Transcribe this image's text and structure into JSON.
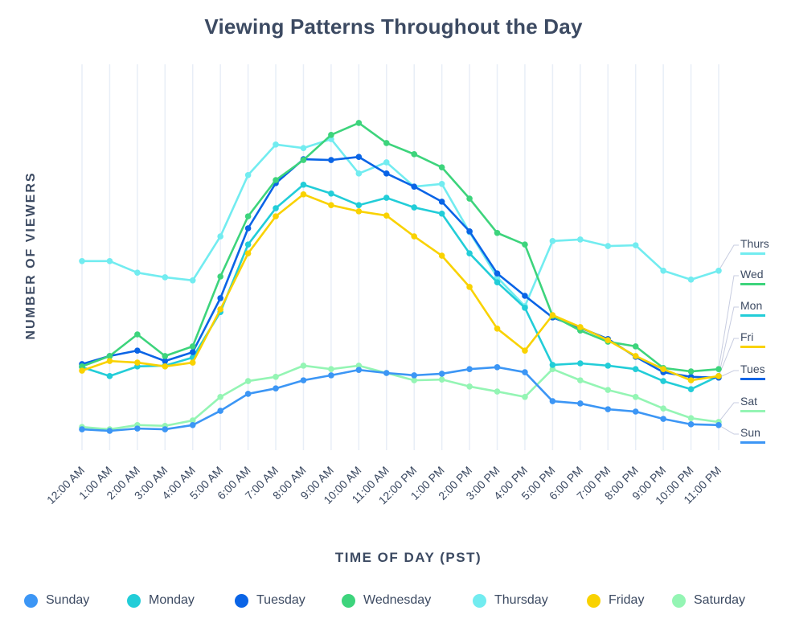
{
  "chart_data": {
    "type": "line",
    "title": "Viewing Patterns Throughout the Day",
    "xlabel": "TIME OF DAY (PST)",
    "ylabel": "NUMBER OF VIEWERS",
    "y_units": "relative index (no y-axis ticks shown)",
    "ylim": [
      0,
      100
    ],
    "grid": "vertical",
    "legend_position": "bottom",
    "categories": [
      "12:00 AM",
      "1:00 AM",
      "2:00 AM",
      "3:00 AM",
      "4:00 AM",
      "5:00 AM",
      "6:00 AM",
      "7:00 AM",
      "8:00 AM",
      "9:00 AM",
      "10:00 AM",
      "11:00 AM",
      "12:00 PM",
      "1:00 PM",
      "2:00 PM",
      "3:00 PM",
      "4:00 PM",
      "5:00 PM",
      "6:00 PM",
      "7:00 PM",
      "8:00 PM",
      "9:00 PM",
      "10:00 PM",
      "11:00 PM"
    ],
    "series": [
      {
        "name": "Sunday",
        "short": "Sun",
        "color": "#3c96f5",
        "values": [
          5.4,
          5.0,
          5.6,
          5.4,
          6.5,
          10.2,
          14.6,
          16.0,
          18.1,
          19.4,
          20.8,
          20.0,
          19.4,
          19.8,
          21.0,
          21.5,
          20.2,
          12.7,
          12.1,
          10.6,
          10.0,
          8.1,
          6.7,
          6.5
        ]
      },
      {
        "name": "Monday",
        "short": "Mon",
        "color": "#22cdd8",
        "values": [
          21.5,
          19.2,
          21.7,
          21.9,
          24.0,
          35.8,
          53.3,
          62.7,
          68.8,
          66.5,
          63.5,
          65.4,
          62.9,
          61.3,
          51.0,
          43.5,
          36.9,
          22.1,
          22.5,
          21.9,
          21.0,
          17.9,
          15.8,
          19.2
        ]
      },
      {
        "name": "Tuesday",
        "short": "Tues",
        "color": "#0a64e6",
        "values": [
          22.3,
          24.4,
          25.8,
          23.1,
          25.4,
          39.4,
          57.5,
          69.2,
          75.4,
          75.2,
          76.0,
          71.7,
          68.3,
          64.4,
          56.7,
          45.8,
          40.0,
          34.4,
          31.7,
          28.8,
          24.2,
          20.2,
          19.0,
          18.8
        ]
      },
      {
        "name": "Wednesday",
        "short": "Wed",
        "color": "#3dd47c",
        "values": [
          21.7,
          24.4,
          30.0,
          24.4,
          26.9,
          45.0,
          60.6,
          70.0,
          75.2,
          81.7,
          84.8,
          79.6,
          76.7,
          73.3,
          65.2,
          56.3,
          53.3,
          34.8,
          31.0,
          28.1,
          26.9,
          21.3,
          20.4,
          21.0
        ]
      },
      {
        "name": "Thursday",
        "short": "Thurs",
        "color": "#72ecf0",
        "values": [
          49.0,
          49.0,
          46.0,
          44.8,
          44.0,
          55.4,
          71.3,
          79.2,
          78.3,
          80.6,
          71.7,
          74.6,
          68.3,
          69.0,
          56.5,
          44.8,
          37.3,
          54.2,
          54.6,
          52.9,
          53.1,
          46.5,
          44.2,
          46.5
        ]
      },
      {
        "name": "Friday",
        "short": "Fri",
        "color": "#f9d200",
        "values": [
          20.6,
          23.1,
          22.7,
          21.7,
          22.7,
          36.5,
          51.0,
          60.6,
          66.3,
          63.5,
          61.9,
          60.8,
          55.4,
          50.4,
          42.3,
          31.5,
          25.8,
          35.0,
          31.9,
          28.5,
          24.4,
          21.0,
          18.1,
          19.2
        ]
      },
      {
        "name": "Saturday",
        "short": "Sat",
        "color": "#94f5b4",
        "values": [
          6.0,
          5.4,
          6.5,
          6.3,
          7.7,
          13.8,
          17.9,
          19.0,
          21.9,
          21.0,
          21.9,
          20.0,
          18.1,
          18.3,
          16.5,
          15.2,
          13.8,
          21.0,
          18.1,
          15.6,
          13.8,
          10.8,
          8.3,
          7.3
        ]
      }
    ],
    "end_labels_order": [
      "Thurs",
      "Wed",
      "Mon",
      "Fri",
      "Tues",
      "Sat",
      "Sun"
    ]
  }
}
